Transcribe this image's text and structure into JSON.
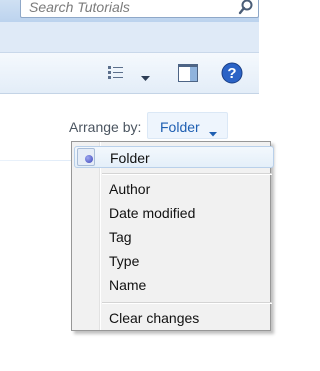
{
  "search": {
    "placeholder": "Search Tutorials",
    "icon": "search-icon"
  },
  "toolbar": {
    "views_icon": "views-icon",
    "views_dropdown_icon": "chevron-down-icon",
    "preview_pane_icon": "preview-pane-icon",
    "help_icon": "help-icon",
    "help_glyph": "?"
  },
  "arrange": {
    "label": "Arrange by:",
    "value": "Folder",
    "chevron_icon": "chevron-down-icon"
  },
  "menu": {
    "items": [
      {
        "label": "Folder",
        "selected": true
      },
      {
        "label": "Author"
      },
      {
        "label": "Date modified"
      },
      {
        "label": "Tag"
      },
      {
        "label": "Type"
      },
      {
        "label": "Name"
      },
      {
        "label": "Clear changes"
      }
    ]
  },
  "colors": {
    "accent": "#1e5fb2",
    "menu_bg": "#f1f1f1",
    "help_blue": "#2b63c6"
  }
}
